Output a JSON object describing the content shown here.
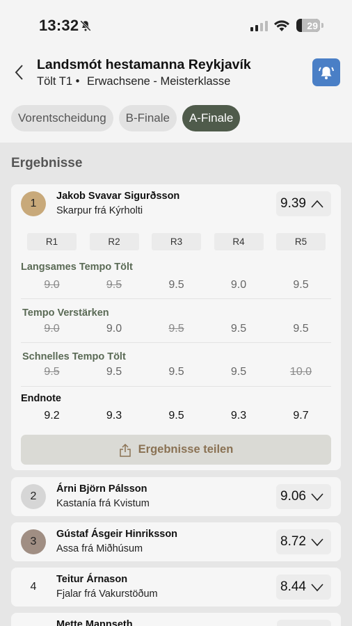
{
  "status": {
    "time": "13:32",
    "battery": "29"
  },
  "header": {
    "title": "Landsmót hestamanna Reykjavík",
    "subtitle_class": "Tölt T1 •",
    "subtitle_division": "Erwachsene - Meisterklasse"
  },
  "tabs": [
    {
      "label": "Vorentscheidung",
      "active": false
    },
    {
      "label": "B-Finale",
      "active": false
    },
    {
      "label": "A-Finale",
      "active": true
    }
  ],
  "section_title": "Ergebnisse",
  "colors": {
    "accent": "#4f5b4b",
    "notify": "#4a7fc6",
    "gold": "#c8a97a",
    "silver": "#d6d6d6",
    "bronze": "#a08e83"
  },
  "round_headers": [
    "R1",
    "R2",
    "R3",
    "R4",
    "R5"
  ],
  "results": [
    {
      "rank": "1",
      "rider": "Jakob Svavar Sigurðsson",
      "horse": "Skarpur frá Kýrholti",
      "score": "9.39",
      "expanded": true,
      "categories": [
        {
          "name": "Langsames Tempo Tölt",
          "values": [
            "9.0",
            "9.5",
            "9.5",
            "9.0",
            "9.5"
          ],
          "struck": [
            true,
            true,
            false,
            false,
            false
          ]
        },
        {
          "name": "Tempo Verstärken",
          "values": [
            "9.0",
            "9.0",
            "9.5",
            "9.5",
            "9.5"
          ],
          "struck": [
            true,
            false,
            true,
            false,
            false
          ]
        },
        {
          "name": "Schnelles Tempo Tölt",
          "values": [
            "9.5",
            "9.5",
            "9.5",
            "9.5",
            "10.0"
          ],
          "struck": [
            true,
            false,
            false,
            false,
            true
          ]
        }
      ],
      "endnote_label": "Endnote",
      "endnote": [
        "9.2",
        "9.3",
        "9.5",
        "9.3",
        "9.7"
      ],
      "share_label": "Ergebnisse teilen"
    },
    {
      "rank": "2",
      "rider": "Árni Björn Pálsson",
      "horse": "Kastanía frá Kvistum",
      "score": "9.06"
    },
    {
      "rank": "3",
      "rider": "Gústaf Ásgeir Hinriksson",
      "horse": "Assa frá Miðhúsum",
      "score": "8.72"
    },
    {
      "rank": "4",
      "rider": "Teitur Árnason",
      "horse": "Fjalar frá Vakurstöðum",
      "score": "8.44"
    },
    {
      "rank": "",
      "rider": "Mette Mannseth",
      "horse": "",
      "score": ""
    }
  ]
}
